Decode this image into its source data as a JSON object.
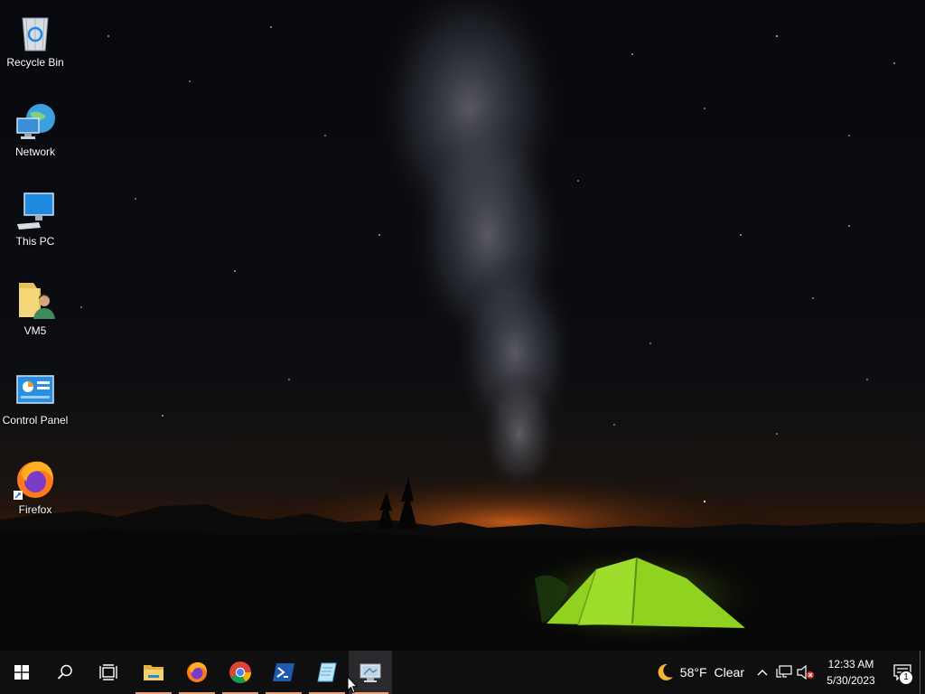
{
  "desktop": {
    "icons": [
      {
        "label": "Recycle Bin",
        "icon": "recycle-bin-icon"
      },
      {
        "label": "Network",
        "icon": "network-icon"
      },
      {
        "label": "This PC",
        "icon": "this-pc-icon"
      },
      {
        "label": "VM5",
        "icon": "user-folder-icon"
      },
      {
        "label": "Control Panel",
        "icon": "control-panel-icon"
      },
      {
        "label": "Firefox",
        "icon": "firefox-icon"
      }
    ]
  },
  "taskbar": {
    "start": "windows-start-icon",
    "search": "search-icon",
    "task_view": "task-view-icon",
    "pinned": [
      {
        "name": "File Explorer",
        "icon": "file-explorer-icon",
        "running": true
      },
      {
        "name": "Firefox",
        "icon": "firefox-icon",
        "running": true
      },
      {
        "name": "Google Chrome",
        "icon": "chrome-icon",
        "running": true
      },
      {
        "name": "PowerShell",
        "icon": "powershell-icon",
        "running": true
      },
      {
        "name": "Notepad",
        "icon": "notepad-icon",
        "running": true
      },
      {
        "name": "Remote Desktop",
        "icon": "remote-desktop-icon",
        "running": true,
        "active": true
      }
    ],
    "accent_color": "#e9a178"
  },
  "tray": {
    "weather_icon": "moon-icon",
    "temperature": "58°F",
    "condition": "Clear",
    "time": "12:33 AM",
    "date": "5/30/2023",
    "notification_count": "1"
  }
}
